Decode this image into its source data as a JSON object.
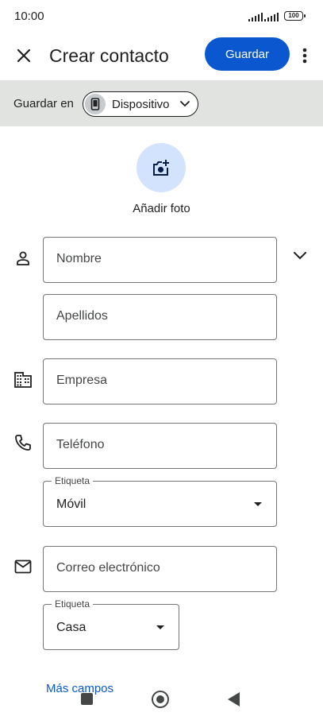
{
  "status_bar": {
    "time": "10:00",
    "battery": "100"
  },
  "header": {
    "title": "Crear contacto",
    "save_label": "Guardar"
  },
  "save_in": {
    "label": "Guardar en",
    "account": "Dispositivo"
  },
  "photo": {
    "label": "Añadir foto"
  },
  "fields": {
    "first_name_placeholder": "Nombre",
    "last_name_placeholder": "Apellidos",
    "company_placeholder": "Empresa",
    "phone_placeholder": "Teléfono",
    "phone_label_caption": "Etiqueta",
    "phone_label_value": "Móvil",
    "email_placeholder": "Correo electrónico",
    "email_label_caption": "Etiqueta",
    "email_label_value": "Casa"
  },
  "more_fields": "Más campos",
  "icons": {
    "close": "close-icon",
    "more": "more-vert-icon",
    "device": "phone-device-icon",
    "photo": "add-photo-icon",
    "person": "person-icon",
    "company": "business-icon",
    "phone": "phone-icon",
    "email": "mail-icon"
  },
  "colors": {
    "accent": "#0b57d0",
    "photo_bg": "#d3e3fd",
    "bar_bg": "#e1e3e1"
  }
}
